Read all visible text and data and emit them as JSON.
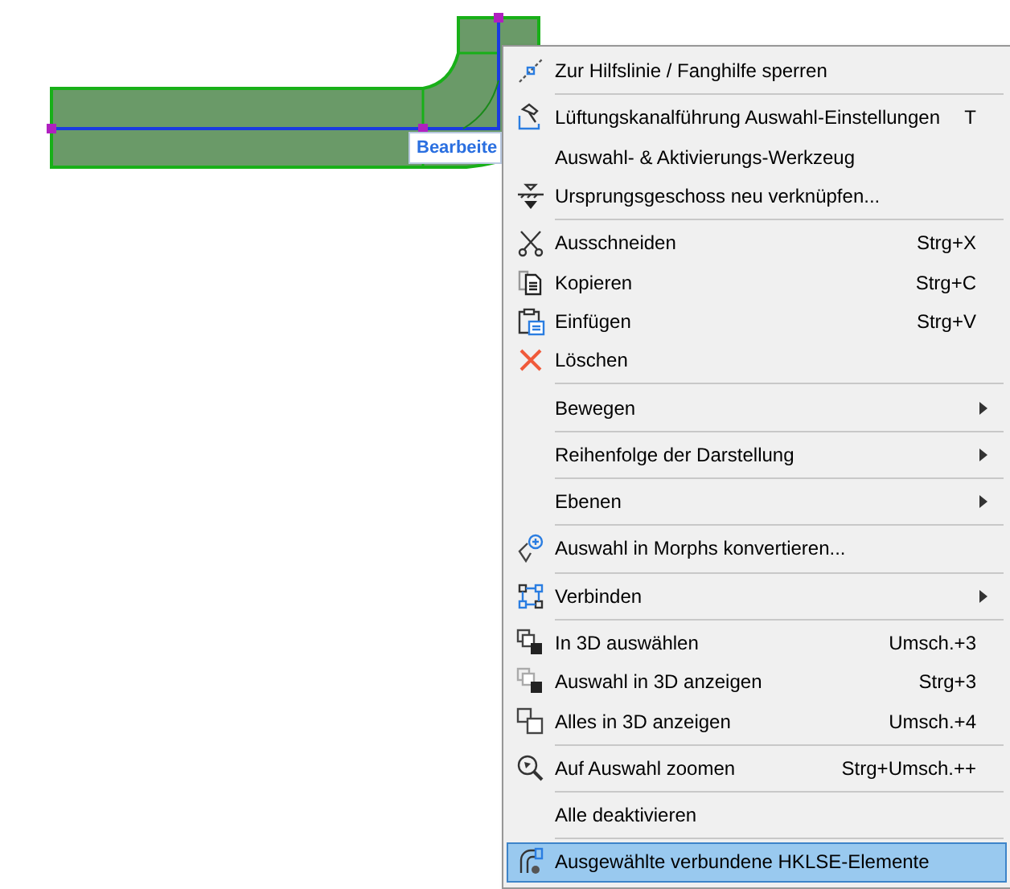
{
  "canvas": {
    "tooltip": "Bearbeite"
  },
  "context_menu": {
    "groups": [
      [
        {
          "label": "Zur Hilfslinie / Fanghilfe sperren",
          "submenu": false,
          "selected": false
        }
      ],
      [
        {
          "label": "Lüftungskanalführung Auswahl-Einstellungen",
          "shortcut": "T",
          "submenu": false,
          "selected": false
        },
        {
          "label": "Auswahl- & Aktivierungs-Werkzeug",
          "submenu": false,
          "selected": false
        },
        {
          "label": "Ursprungsgeschoss neu verknüpfen...",
          "submenu": false,
          "selected": false
        }
      ],
      [
        {
          "label": "Ausschneiden",
          "shortcut": "Strg+X",
          "submenu": false,
          "selected": false
        },
        {
          "label": "Kopieren",
          "shortcut": "Strg+C",
          "submenu": false,
          "selected": false
        },
        {
          "label": "Einfügen",
          "shortcut": "Strg+V",
          "submenu": false,
          "selected": false
        },
        {
          "label": "Löschen",
          "submenu": false,
          "selected": false
        }
      ],
      [
        {
          "label": "Bewegen",
          "submenu": true,
          "selected": false
        }
      ],
      [
        {
          "label": "Reihenfolge der Darstellung",
          "submenu": true,
          "selected": false
        }
      ],
      [
        {
          "label": "Ebenen",
          "submenu": true,
          "selected": false
        }
      ],
      [
        {
          "label": "Auswahl in Morphs konvertieren...",
          "submenu": false,
          "selected": false
        }
      ],
      [
        {
          "label": "Verbinden",
          "submenu": true,
          "selected": false
        }
      ],
      [
        {
          "label": "In 3D auswählen",
          "shortcut": "Umsch.+3",
          "submenu": false,
          "selected": false
        },
        {
          "label": "Auswahl in 3D anzeigen",
          "shortcut": "Strg+3",
          "submenu": false,
          "selected": false
        },
        {
          "label": "Alles in 3D anzeigen",
          "shortcut": "Umsch.+4",
          "submenu": false,
          "selected": false
        }
      ],
      [
        {
          "label": "Auf Auswahl zoomen",
          "shortcut": "Strg+Umsch.++",
          "submenu": false,
          "selected": false
        }
      ],
      [
        {
          "label": "Alle deaktivieren",
          "submenu": false,
          "selected": false
        }
      ],
      [
        {
          "label": "Ausgewählte verbundene HKLSE-Elemente",
          "submenu": false,
          "selected": true
        }
      ]
    ]
  }
}
